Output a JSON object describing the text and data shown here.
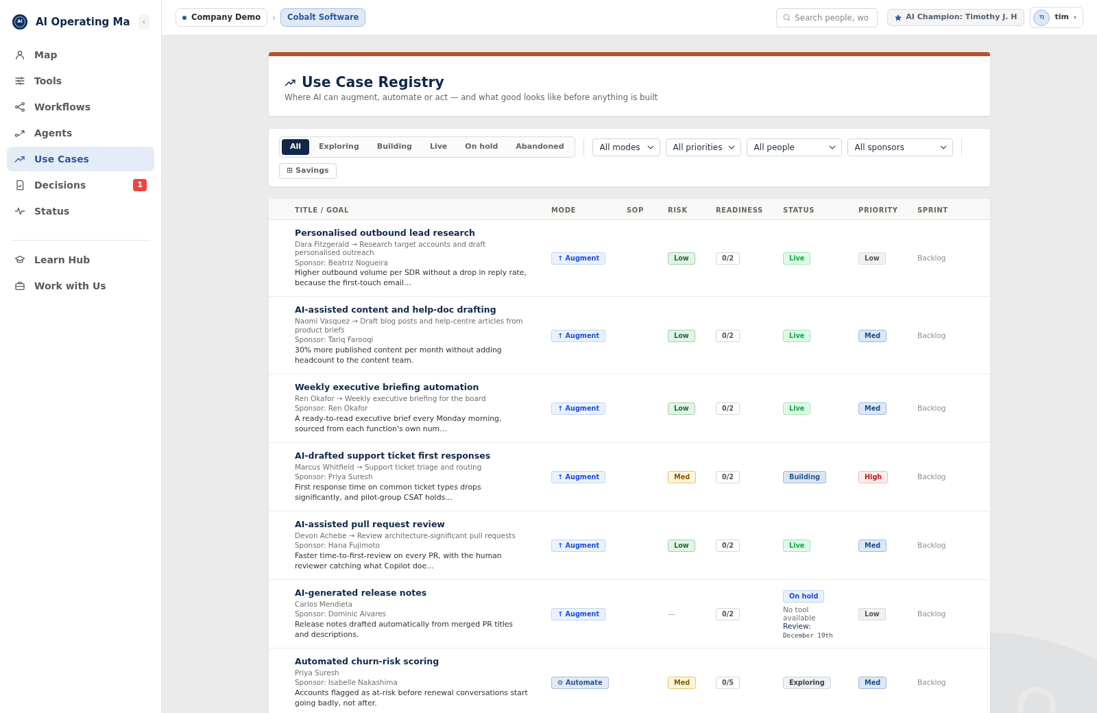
{
  "sidebar": {
    "logo_mark": "AI",
    "title": "AI Operating Ma",
    "collapse_button": "‹",
    "items": [
      {
        "label": "Map",
        "selected": false
      },
      {
        "label": "Tools",
        "selected": false
      },
      {
        "label": "Workflows",
        "selected": false
      },
      {
        "label": "Agents",
        "selected": false
      },
      {
        "label": "Use Cases",
        "selected": true
      },
      {
        "label": "Decisions",
        "selected": false,
        "badge": "1"
      },
      {
        "label": "Status",
        "selected": false
      }
    ],
    "secondary_items": [
      {
        "label": "Learn Hub",
        "selected": false
      },
      {
        "label": "Work with Us",
        "selected": false
      }
    ]
  },
  "topbar": {
    "breadcrumbs": [
      {
        "label": "Company Demo",
        "selected": false,
        "dot": true
      },
      {
        "label": "Cobalt Software",
        "selected": true,
        "dot": false
      }
    ],
    "breadcrumb_separator": "›",
    "search": {
      "placeholder": "Search people, wo"
    },
    "champion": {
      "label": "AI Champion: Timothy J. H"
    },
    "user": {
      "initials": "TJ",
      "name": "tim",
      "caret": "▾"
    }
  },
  "page_header": {
    "title": "Use Case Registry",
    "subtitle": "Where AI can augment, automate or act — and what good looks like before anything is built"
  },
  "filters": {
    "tabs": [
      {
        "label": "All",
        "selected": true
      },
      {
        "label": "Exploring",
        "selected": false
      },
      {
        "label": "Building",
        "selected": false
      },
      {
        "label": "Live",
        "selected": false
      },
      {
        "label": "On hold",
        "selected": false
      },
      {
        "label": "Abandoned",
        "selected": false
      }
    ],
    "selects": [
      {
        "value": "All modes"
      },
      {
        "value": "All priorities"
      },
      {
        "value": "All people"
      },
      {
        "value": "All sponsors"
      }
    ],
    "savings_button": "⊞ Savings"
  },
  "table": {
    "columns": [
      "TITLE / GOAL",
      "MODE",
      "SOP",
      "RISK",
      "READINESS",
      "STATUS",
      "PRIORITY",
      "SPRINT"
    ],
    "rows": [
      {
        "title": "Personalised outbound lead research",
        "owner": "Dara Fitzgerald → Research target accounts and draft personalised outreach",
        "sponsor": "Sponsor: Beatriz Nogueira",
        "goal": "Higher outbound volume per SDR without a drop in reply rate, because the first-touch email…",
        "mode": {
          "label": "↑ Augment",
          "kind": "augment"
        },
        "risk": {
          "label": "Low",
          "kind": "low"
        },
        "readiness": "0/2",
        "status": {
          "label": "Live",
          "kind": "live"
        },
        "priority": {
          "label": "Low",
          "kind": "low"
        },
        "sprint": "Backlog"
      },
      {
        "title": "AI-assisted content and help-doc drafting",
        "owner": "Naomi Vasquez → Draft blog posts and help-centre articles from product briefs",
        "sponsor": "Sponsor: Tariq Farooqi",
        "goal": "30% more published content per month without adding headcount to the content team.",
        "mode": {
          "label": "↑ Augment",
          "kind": "augment"
        },
        "risk": {
          "label": "Low",
          "kind": "low"
        },
        "readiness": "0/2",
        "status": {
          "label": "Live",
          "kind": "live"
        },
        "priority": {
          "label": "Med",
          "kind": "med"
        },
        "sprint": "Backlog"
      },
      {
        "title": "Weekly executive briefing automation",
        "owner": "Ren Okafor → Weekly executive briefing for the board",
        "sponsor": "Sponsor: Ren Okafor",
        "goal": "A ready-to-read executive brief every Monday morning, sourced from each function's own num…",
        "mode": {
          "label": "↑ Augment",
          "kind": "augment"
        },
        "risk": {
          "label": "Low",
          "kind": "low"
        },
        "readiness": "0/2",
        "status": {
          "label": "Live",
          "kind": "live"
        },
        "priority": {
          "label": "Med",
          "kind": "med"
        },
        "sprint": "Backlog"
      },
      {
        "title": "AI-drafted support ticket first responses",
        "owner": "Marcus Whitfield → Support ticket triage and routing",
        "sponsor": "Sponsor: Priya Suresh",
        "goal": "First response time on common ticket types drops significantly, and pilot-group CSAT holds…",
        "mode": {
          "label": "↑ Augment",
          "kind": "augment"
        },
        "risk": {
          "label": "Med",
          "kind": "med"
        },
        "readiness": "0/2",
        "status": {
          "label": "Building",
          "kind": "building"
        },
        "priority": {
          "label": "High",
          "kind": "high"
        },
        "sprint": "Backlog"
      },
      {
        "title": "AI-assisted pull request review",
        "owner": "Devon Achebe → Review architecture-significant pull requests",
        "sponsor": "Sponsor: Hana Fujimoto",
        "goal": "Faster time-to-first-review on every PR, with the human reviewer catching what Copilot doe…",
        "mode": {
          "label": "↑ Augment",
          "kind": "augment"
        },
        "risk": {
          "label": "Low",
          "kind": "low"
        },
        "readiness": "0/2",
        "status": {
          "label": "Live",
          "kind": "live"
        },
        "priority": {
          "label": "Med",
          "kind": "med"
        },
        "sprint": "Backlog"
      },
      {
        "title": "AI-generated release notes",
        "owner": "Carlos Mendieta",
        "sponsor": "Sponsor: Dominic Alvares",
        "goal": "Release notes drafted automatically from merged PR titles and descriptions.",
        "mode": {
          "label": "↑ Augment",
          "kind": "augment"
        },
        "risk": {
          "label": "—",
          "kind": "none"
        },
        "readiness": "0/2",
        "status": {
          "label": "On hold",
          "kind": "on_hold",
          "note": "No tool available",
          "review_label": "Review:",
          "review_date": "December 19th"
        },
        "priority": {
          "label": "Low",
          "kind": "low"
        },
        "sprint": "Backlog"
      },
      {
        "title": "Automated churn-risk scoring",
        "owner": "Priya Suresh",
        "sponsor": "Sponsor: Isabelle Nakashima",
        "goal": "Accounts flagged as at-risk before renewal conversations start going badly, not after.",
        "mode": {
          "label": "⚙ Automate",
          "kind": "automate"
        },
        "risk": {
          "label": "Med",
          "kind": "med"
        },
        "readiness": "0/5",
        "status": {
          "label": "Exploring",
          "kind": "exploring"
        },
        "priority": {
          "label": "Med",
          "kind": "med"
        },
        "sprint": "Backlog"
      }
    ]
  }
}
